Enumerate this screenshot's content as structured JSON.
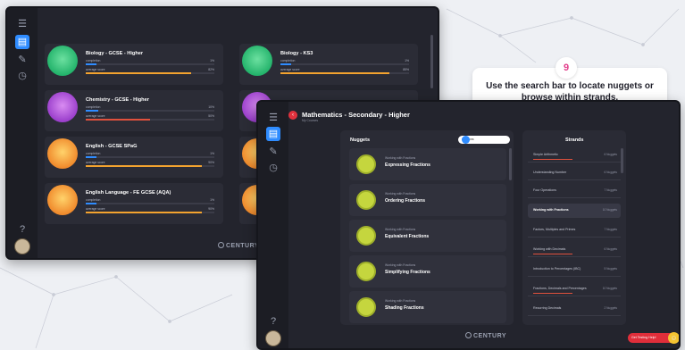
{
  "background": {
    "color": "#eef0f4",
    "network_color": "#c9ccd6"
  },
  "window_a": {
    "logo": "CENTURY",
    "courses": [
      {
        "title": "Biology - GCSE - Higher",
        "completion_label": "completion",
        "completion_value": "1%",
        "completion_pct": 1,
        "score_label": "average score",
        "score_value": "82%",
        "score_pct": 82,
        "thumb_color": "#23b36b",
        "bar_color": "#f3a32f"
      },
      {
        "title": "Biology - KS3",
        "completion_label": "completion",
        "completion_value": "1%",
        "completion_pct": 1,
        "score_label": "average score",
        "score_value": "85%",
        "score_pct": 85,
        "thumb_color": "#23b36b",
        "bar_color": "#f3a32f"
      },
      {
        "title": "Chemistry - GCSE - Higher",
        "completion_label": "completion",
        "completion_value": "10%",
        "completion_pct": 10,
        "score_label": "average score",
        "score_value": "50%",
        "score_pct": 50,
        "thumb_color": "#9b3fcc",
        "bar_color": "#e0513d"
      },
      {
        "title": "",
        "thumb_color": "#9b3fcc"
      },
      {
        "title": "English - GCSE SPaG",
        "completion_label": "completion",
        "completion_value": "1%",
        "completion_pct": 1,
        "score_label": "average score",
        "score_value": "90%",
        "score_pct": 90,
        "thumb_color": "#f08a2c",
        "bar_color": "#f3a32f"
      },
      {
        "title": "",
        "thumb_color": "#f08a2c"
      },
      {
        "title": "English Language - FE GCSE (AQA)",
        "completion_label": "completion",
        "completion_value": "1%",
        "completion_pct": 1,
        "score_label": "average score",
        "score_value": "90%",
        "score_pct": 90,
        "thumb_color": "#f08a2c",
        "bar_color": "#f3a32f"
      },
      {
        "title": "",
        "thumb_color": "#f08a2c"
      }
    ]
  },
  "callout": {
    "step": "9",
    "text": "Use the search bar to locate nuggets or browse within strands."
  },
  "window_b": {
    "header_title": "Mathematics - Secondary - Higher",
    "header_sub": "My Courses",
    "nuggets_title": "Nuggets",
    "search_value": "fractions",
    "strands_title": "Strands",
    "nugget_sub": "Working with Fractions",
    "nuggets": [
      {
        "name": "Expressing Fractions"
      },
      {
        "name": "Ordering Fractions"
      },
      {
        "name": "Equivalent Fractions"
      },
      {
        "name": "Simplifying Fractions"
      },
      {
        "name": "Shading Fractions"
      }
    ],
    "strands": [
      {
        "name": "Simple Arithmetic",
        "count": "6 Nuggets",
        "progress": 1
      },
      {
        "name": "Understanding Number",
        "count": "6 Nuggets",
        "progress": 0
      },
      {
        "name": "Four Operations",
        "count": "7 Nuggets",
        "progress": 0
      },
      {
        "name": "Working with Fractions",
        "count": "10 Nuggets",
        "progress": 0
      },
      {
        "name": "Factors, Multiples and Primes",
        "count": "7 Nuggets",
        "progress": 0
      },
      {
        "name": "Working with Decimals",
        "count": "6 Nuggets",
        "progress": 1
      },
      {
        "name": "Introduction to Percentages (IBC)",
        "count": "5 Nuggets",
        "progress": 0
      },
      {
        "name": "Fractions, Decimals and Percentages",
        "count": "10 Nuggets",
        "progress": 1
      },
      {
        "name": "Recurring Decimals",
        "count": "2 Nuggets",
        "progress": 0
      }
    ],
    "logo": "CENTURY",
    "help_label": "Get Testing Help!",
    "accent": "#2f8cff"
  }
}
